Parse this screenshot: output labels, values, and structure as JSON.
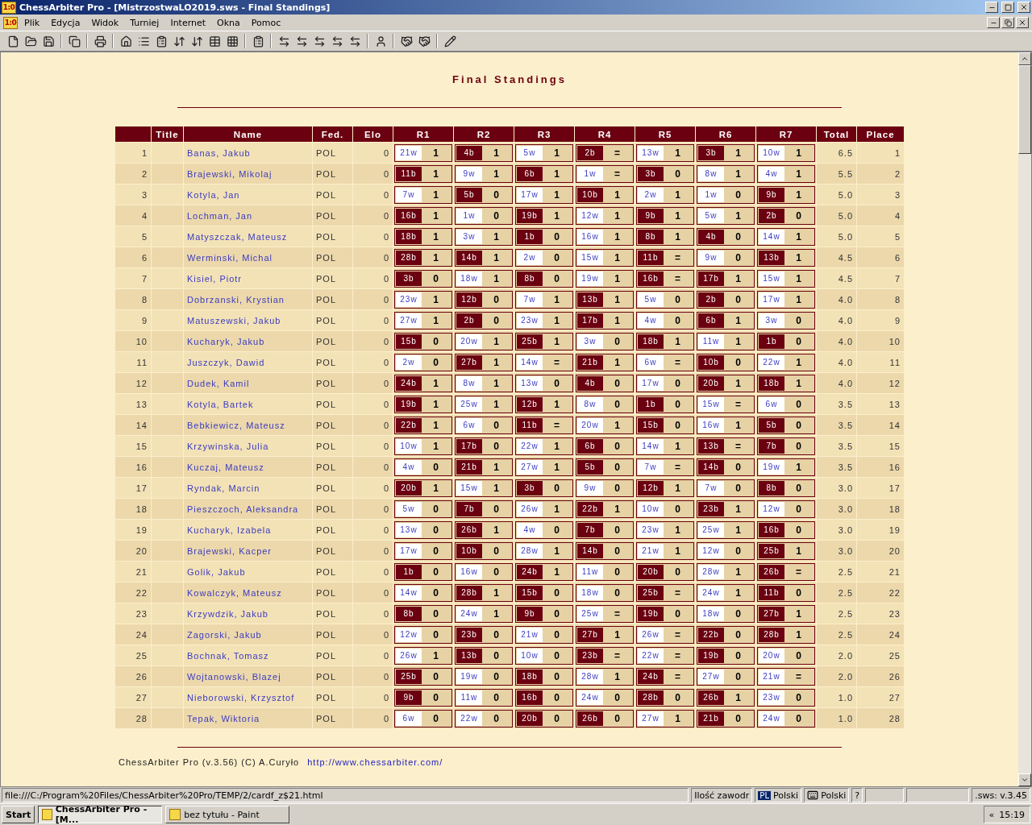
{
  "window": {
    "icon_text": "1:0",
    "title": "ChessArbiter Pro - [MistrzostwaLO2019.sws - Final Standings]"
  },
  "menu": {
    "icon_text": "1:0",
    "items": [
      "Plik",
      "Edycja",
      "Widok",
      "Turniej",
      "Internet",
      "Okna",
      "Pomoc"
    ]
  },
  "page": {
    "heading": "Final Standings",
    "columns": [
      "",
      "Title",
      "Name",
      "Fed.",
      "Elo",
      "R1",
      "R2",
      "R3",
      "R4",
      "R5",
      "R6",
      "R7",
      "Total",
      "Place"
    ],
    "rows": [
      {
        "no": "1",
        "name": "Banas, Jakub",
        "fed": "POL",
        "elo": "0",
        "rounds": [
          {
            "opp": "21w",
            "black": false,
            "result": "1"
          },
          {
            "opp": "4b",
            "black": true,
            "result": "1"
          },
          {
            "opp": "5w",
            "black": false,
            "result": "1"
          },
          {
            "opp": "2b",
            "black": true,
            "result": "="
          },
          {
            "opp": "13w",
            "black": false,
            "result": "1"
          },
          {
            "opp": "3b",
            "black": true,
            "result": "1"
          },
          {
            "opp": "10w",
            "black": false,
            "result": "1"
          }
        ],
        "total": "6.5",
        "place": "1"
      },
      {
        "no": "2",
        "name": "Brajewski, Mikolaj",
        "fed": "POL",
        "elo": "0",
        "rounds": [
          {
            "opp": "11b",
            "black": true,
            "result": "1"
          },
          {
            "opp": "9w",
            "black": false,
            "result": "1"
          },
          {
            "opp": "6b",
            "black": true,
            "result": "1"
          },
          {
            "opp": "1w",
            "black": false,
            "result": "="
          },
          {
            "opp": "3b",
            "black": true,
            "result": "0"
          },
          {
            "opp": "8w",
            "black": false,
            "result": "1"
          },
          {
            "opp": "4w",
            "black": false,
            "result": "1"
          }
        ],
        "total": "5.5",
        "place": "2"
      },
      {
        "no": "3",
        "name": "Kotyla, Jan",
        "fed": "POL",
        "elo": "0",
        "rounds": [
          {
            "opp": "7w",
            "black": false,
            "result": "1"
          },
          {
            "opp": "5b",
            "black": true,
            "result": "0"
          },
          {
            "opp": "17w",
            "black": false,
            "result": "1"
          },
          {
            "opp": "10b",
            "black": true,
            "result": "1"
          },
          {
            "opp": "2w",
            "black": false,
            "result": "1"
          },
          {
            "opp": "1w",
            "black": false,
            "result": "0"
          },
          {
            "opp": "9b",
            "black": true,
            "result": "1"
          }
        ],
        "total": "5.0",
        "place": "3"
      },
      {
        "no": "4",
        "name": "Lochman, Jan",
        "fed": "POL",
        "elo": "0",
        "rounds": [
          {
            "opp": "16b",
            "black": true,
            "result": "1"
          },
          {
            "opp": "1w",
            "black": false,
            "result": "0"
          },
          {
            "opp": "19b",
            "black": true,
            "result": "1"
          },
          {
            "opp": "12w",
            "black": false,
            "result": "1"
          },
          {
            "opp": "9b",
            "black": true,
            "result": "1"
          },
          {
            "opp": "5w",
            "black": false,
            "result": "1"
          },
          {
            "opp": "2b",
            "black": true,
            "result": "0"
          }
        ],
        "total": "5.0",
        "place": "4"
      },
      {
        "no": "5",
        "name": "Matyszczak, Mateusz",
        "fed": "POL",
        "elo": "0",
        "rounds": [
          {
            "opp": "18b",
            "black": true,
            "result": "1"
          },
          {
            "opp": "3w",
            "black": false,
            "result": "1"
          },
          {
            "opp": "1b",
            "black": true,
            "result": "0"
          },
          {
            "opp": "16w",
            "black": false,
            "result": "1"
          },
          {
            "opp": "8b",
            "black": true,
            "result": "1"
          },
          {
            "opp": "4b",
            "black": true,
            "result": "0"
          },
          {
            "opp": "14w",
            "black": false,
            "result": "1"
          }
        ],
        "total": "5.0",
        "place": "5"
      },
      {
        "no": "6",
        "name": "Werminski, Michal",
        "fed": "POL",
        "elo": "0",
        "rounds": [
          {
            "opp": "28b",
            "black": true,
            "result": "1"
          },
          {
            "opp": "14b",
            "black": true,
            "result": "1"
          },
          {
            "opp": "2w",
            "black": false,
            "result": "0"
          },
          {
            "opp": "15w",
            "black": false,
            "result": "1"
          },
          {
            "opp": "11b",
            "black": true,
            "result": "="
          },
          {
            "opp": "9w",
            "black": false,
            "result": "0"
          },
          {
            "opp": "13b",
            "black": true,
            "result": "1"
          }
        ],
        "total": "4.5",
        "place": "6"
      },
      {
        "no": "7",
        "name": "Kisiel, Piotr",
        "fed": "POL",
        "elo": "0",
        "rounds": [
          {
            "opp": "3b",
            "black": true,
            "result": "0"
          },
          {
            "opp": "18w",
            "black": false,
            "result": "1"
          },
          {
            "opp": "8b",
            "black": true,
            "result": "0"
          },
          {
            "opp": "19w",
            "black": false,
            "result": "1"
          },
          {
            "opp": "16b",
            "black": true,
            "result": "="
          },
          {
            "opp": "17b",
            "black": true,
            "result": "1"
          },
          {
            "opp": "15w",
            "black": false,
            "result": "1"
          }
        ],
        "total": "4.5",
        "place": "7"
      },
      {
        "no": "8",
        "name": "Dobrzanski, Krystian",
        "fed": "POL",
        "elo": "0",
        "rounds": [
          {
            "opp": "23w",
            "black": false,
            "result": "1"
          },
          {
            "opp": "12b",
            "black": true,
            "result": "0"
          },
          {
            "opp": "7w",
            "black": false,
            "result": "1"
          },
          {
            "opp": "13b",
            "black": true,
            "result": "1"
          },
          {
            "opp": "5w",
            "black": false,
            "result": "0"
          },
          {
            "opp": "2b",
            "black": true,
            "result": "0"
          },
          {
            "opp": "17w",
            "black": false,
            "result": "1"
          }
        ],
        "total": "4.0",
        "place": "8"
      },
      {
        "no": "9",
        "name": "Matuszewski, Jakub",
        "fed": "POL",
        "elo": "0",
        "rounds": [
          {
            "opp": "27w",
            "black": false,
            "result": "1"
          },
          {
            "opp": "2b",
            "black": true,
            "result": "0"
          },
          {
            "opp": "23w",
            "black": false,
            "result": "1"
          },
          {
            "opp": "17b",
            "black": true,
            "result": "1"
          },
          {
            "opp": "4w",
            "black": false,
            "result": "0"
          },
          {
            "opp": "6b",
            "black": true,
            "result": "1"
          },
          {
            "opp": "3w",
            "black": false,
            "result": "0"
          }
        ],
        "total": "4.0",
        "place": "9"
      },
      {
        "no": "10",
        "name": "Kucharyk, Jakub",
        "fed": "POL",
        "elo": "0",
        "rounds": [
          {
            "opp": "15b",
            "black": true,
            "result": "0"
          },
          {
            "opp": "20w",
            "black": false,
            "result": "1"
          },
          {
            "opp": "25b",
            "black": true,
            "result": "1"
          },
          {
            "opp": "3w",
            "black": false,
            "result": "0"
          },
          {
            "opp": "18b",
            "black": true,
            "result": "1"
          },
          {
            "opp": "11w",
            "black": false,
            "result": "1"
          },
          {
            "opp": "1b",
            "black": true,
            "result": "0"
          }
        ],
        "total": "4.0",
        "place": "10"
      },
      {
        "no": "11",
        "name": "Juszczyk, Dawid",
        "fed": "POL",
        "elo": "0",
        "rounds": [
          {
            "opp": "2w",
            "black": false,
            "result": "0"
          },
          {
            "opp": "27b",
            "black": true,
            "result": "1"
          },
          {
            "opp": "14w",
            "black": false,
            "result": "="
          },
          {
            "opp": "21b",
            "black": true,
            "result": "1"
          },
          {
            "opp": "6w",
            "black": false,
            "result": "="
          },
          {
            "opp": "10b",
            "black": true,
            "result": "0"
          },
          {
            "opp": "22w",
            "black": false,
            "result": "1"
          }
        ],
        "total": "4.0",
        "place": "11"
      },
      {
        "no": "12",
        "name": "Dudek, Kamil",
        "fed": "POL",
        "elo": "0",
        "rounds": [
          {
            "opp": "24b",
            "black": true,
            "result": "1"
          },
          {
            "opp": "8w",
            "black": false,
            "result": "1"
          },
          {
            "opp": "13w",
            "black": false,
            "result": "0"
          },
          {
            "opp": "4b",
            "black": true,
            "result": "0"
          },
          {
            "opp": "17w",
            "black": false,
            "result": "0"
          },
          {
            "opp": "20b",
            "black": true,
            "result": "1"
          },
          {
            "opp": "18b",
            "black": true,
            "result": "1"
          }
        ],
        "total": "4.0",
        "place": "12"
      },
      {
        "no": "13",
        "name": "Kotyla, Bartek",
        "fed": "POL",
        "elo": "0",
        "rounds": [
          {
            "opp": "19b",
            "black": true,
            "result": "1"
          },
          {
            "opp": "25w",
            "black": false,
            "result": "1"
          },
          {
            "opp": "12b",
            "black": true,
            "result": "1"
          },
          {
            "opp": "8w",
            "black": false,
            "result": "0"
          },
          {
            "opp": "1b",
            "black": true,
            "result": "0"
          },
          {
            "opp": "15w",
            "black": false,
            "result": "="
          },
          {
            "opp": "6w",
            "black": false,
            "result": "0"
          }
        ],
        "total": "3.5",
        "place": "13"
      },
      {
        "no": "14",
        "name": "Bebkiewicz, Mateusz",
        "fed": "POL",
        "elo": "0",
        "rounds": [
          {
            "opp": "22b",
            "black": true,
            "result": "1"
          },
          {
            "opp": "6w",
            "black": false,
            "result": "0"
          },
          {
            "opp": "11b",
            "black": true,
            "result": "="
          },
          {
            "opp": "20w",
            "black": false,
            "result": "1"
          },
          {
            "opp": "15b",
            "black": true,
            "result": "0"
          },
          {
            "opp": "16w",
            "black": false,
            "result": "1"
          },
          {
            "opp": "5b",
            "black": true,
            "result": "0"
          }
        ],
        "total": "3.5",
        "place": "14"
      },
      {
        "no": "15",
        "name": "Krzywinska, Julia",
        "fed": "POL",
        "elo": "0",
        "rounds": [
          {
            "opp": "10w",
            "black": false,
            "result": "1"
          },
          {
            "opp": "17b",
            "black": true,
            "result": "0"
          },
          {
            "opp": "22w",
            "black": false,
            "result": "1"
          },
          {
            "opp": "6b",
            "black": true,
            "result": "0"
          },
          {
            "opp": "14w",
            "black": false,
            "result": "1"
          },
          {
            "opp": "13b",
            "black": true,
            "result": "="
          },
          {
            "opp": "7b",
            "black": true,
            "result": "0"
          }
        ],
        "total": "3.5",
        "place": "15"
      },
      {
        "no": "16",
        "name": "Kuczaj, Mateusz",
        "fed": "POL",
        "elo": "0",
        "rounds": [
          {
            "opp": "4w",
            "black": false,
            "result": "0"
          },
          {
            "opp": "21b",
            "black": true,
            "result": "1"
          },
          {
            "opp": "27w",
            "black": false,
            "result": "1"
          },
          {
            "opp": "5b",
            "black": true,
            "result": "0"
          },
          {
            "opp": "7w",
            "black": false,
            "result": "="
          },
          {
            "opp": "14b",
            "black": true,
            "result": "0"
          },
          {
            "opp": "19w",
            "black": false,
            "result": "1"
          }
        ],
        "total": "3.5",
        "place": "16"
      },
      {
        "no": "17",
        "name": "Ryndak, Marcin",
        "fed": "POL",
        "elo": "0",
        "rounds": [
          {
            "opp": "20b",
            "black": true,
            "result": "1"
          },
          {
            "opp": "15w",
            "black": false,
            "result": "1"
          },
          {
            "opp": "3b",
            "black": true,
            "result": "0"
          },
          {
            "opp": "9w",
            "black": false,
            "result": "0"
          },
          {
            "opp": "12b",
            "black": true,
            "result": "1"
          },
          {
            "opp": "7w",
            "black": false,
            "result": "0"
          },
          {
            "opp": "8b",
            "black": true,
            "result": "0"
          }
        ],
        "total": "3.0",
        "place": "17"
      },
      {
        "no": "18",
        "name": "Pieszczoch, Aleksandra",
        "fed": "POL",
        "elo": "0",
        "rounds": [
          {
            "opp": "5w",
            "black": false,
            "result": "0"
          },
          {
            "opp": "7b",
            "black": true,
            "result": "0"
          },
          {
            "opp": "26w",
            "black": false,
            "result": "1"
          },
          {
            "opp": "22b",
            "black": true,
            "result": "1"
          },
          {
            "opp": "10w",
            "black": false,
            "result": "0"
          },
          {
            "opp": "23b",
            "black": true,
            "result": "1"
          },
          {
            "opp": "12w",
            "black": false,
            "result": "0"
          }
        ],
        "total": "3.0",
        "place": "18"
      },
      {
        "no": "19",
        "name": "Kucharyk, Izabela",
        "fed": "POL",
        "elo": "0",
        "rounds": [
          {
            "opp": "13w",
            "black": false,
            "result": "0"
          },
          {
            "opp": "26b",
            "black": true,
            "result": "1"
          },
          {
            "opp": "4w",
            "black": false,
            "result": "0"
          },
          {
            "opp": "7b",
            "black": true,
            "result": "0"
          },
          {
            "opp": "23w",
            "black": false,
            "result": "1"
          },
          {
            "opp": "25w",
            "black": false,
            "result": "1"
          },
          {
            "opp": "16b",
            "black": true,
            "result": "0"
          }
        ],
        "total": "3.0",
        "place": "19"
      },
      {
        "no": "20",
        "name": "Brajewski, Kacper",
        "fed": "POL",
        "elo": "0",
        "rounds": [
          {
            "opp": "17w",
            "black": false,
            "result": "0"
          },
          {
            "opp": "10b",
            "black": true,
            "result": "0"
          },
          {
            "opp": "28w",
            "black": false,
            "result": "1"
          },
          {
            "opp": "14b",
            "black": true,
            "result": "0"
          },
          {
            "opp": "21w",
            "black": false,
            "result": "1"
          },
          {
            "opp": "12w",
            "black": false,
            "result": "0"
          },
          {
            "opp": "25b",
            "black": true,
            "result": "1"
          }
        ],
        "total": "3.0",
        "place": "20"
      },
      {
        "no": "21",
        "name": "Golik, Jakub",
        "fed": "POL",
        "elo": "0",
        "rounds": [
          {
            "opp": "1b",
            "black": true,
            "result": "0"
          },
          {
            "opp": "16w",
            "black": false,
            "result": "0"
          },
          {
            "opp": "24b",
            "black": true,
            "result": "1"
          },
          {
            "opp": "11w",
            "black": false,
            "result": "0"
          },
          {
            "opp": "20b",
            "black": true,
            "result": "0"
          },
          {
            "opp": "28w",
            "black": false,
            "result": "1"
          },
          {
            "opp": "26b",
            "black": true,
            "result": "="
          }
        ],
        "total": "2.5",
        "place": "21"
      },
      {
        "no": "22",
        "name": "Kowalczyk, Mateusz",
        "fed": "POL",
        "elo": "0",
        "rounds": [
          {
            "opp": "14w",
            "black": false,
            "result": "0"
          },
          {
            "opp": "28b",
            "black": true,
            "result": "1"
          },
          {
            "opp": "15b",
            "black": true,
            "result": "0"
          },
          {
            "opp": "18w",
            "black": false,
            "result": "0"
          },
          {
            "opp": "25b",
            "black": true,
            "result": "="
          },
          {
            "opp": "24w",
            "black": false,
            "result": "1"
          },
          {
            "opp": "11b",
            "black": true,
            "result": "0"
          }
        ],
        "total": "2.5",
        "place": "22"
      },
      {
        "no": "23",
        "name": "Krzywdzik, Jakub",
        "fed": "POL",
        "elo": "0",
        "rounds": [
          {
            "opp": "8b",
            "black": true,
            "result": "0"
          },
          {
            "opp": "24w",
            "black": false,
            "result": "1"
          },
          {
            "opp": "9b",
            "black": true,
            "result": "0"
          },
          {
            "opp": "25w",
            "black": false,
            "result": "="
          },
          {
            "opp": "19b",
            "black": true,
            "result": "0"
          },
          {
            "opp": "18w",
            "black": false,
            "result": "0"
          },
          {
            "opp": "27b",
            "black": true,
            "result": "1"
          }
        ],
        "total": "2.5",
        "place": "23"
      },
      {
        "no": "24",
        "name": "Zagorski, Jakub",
        "fed": "POL",
        "elo": "0",
        "rounds": [
          {
            "opp": "12w",
            "black": false,
            "result": "0"
          },
          {
            "opp": "23b",
            "black": true,
            "result": "0"
          },
          {
            "opp": "21w",
            "black": false,
            "result": "0"
          },
          {
            "opp": "27b",
            "black": true,
            "result": "1"
          },
          {
            "opp": "26w",
            "black": false,
            "result": "="
          },
          {
            "opp": "22b",
            "black": true,
            "result": "0"
          },
          {
            "opp": "28b",
            "black": true,
            "result": "1"
          }
        ],
        "total": "2.5",
        "place": "24"
      },
      {
        "no": "25",
        "name": "Bochnak, Tomasz",
        "fed": "POL",
        "elo": "0",
        "rounds": [
          {
            "opp": "26w",
            "black": false,
            "result": "1"
          },
          {
            "opp": "13b",
            "black": true,
            "result": "0"
          },
          {
            "opp": "10w",
            "black": false,
            "result": "0"
          },
          {
            "opp": "23b",
            "black": true,
            "result": "="
          },
          {
            "opp": "22w",
            "black": false,
            "result": "="
          },
          {
            "opp": "19b",
            "black": true,
            "result": "0"
          },
          {
            "opp": "20w",
            "black": false,
            "result": "0"
          }
        ],
        "total": "2.0",
        "place": "25"
      },
      {
        "no": "26",
        "name": "Wojtanowski, Blazej",
        "fed": "POL",
        "elo": "0",
        "rounds": [
          {
            "opp": "25b",
            "black": true,
            "result": "0"
          },
          {
            "opp": "19w",
            "black": false,
            "result": "0"
          },
          {
            "opp": "18b",
            "black": true,
            "result": "0"
          },
          {
            "opp": "28w",
            "black": false,
            "result": "1"
          },
          {
            "opp": "24b",
            "black": true,
            "result": "="
          },
          {
            "opp": "27w",
            "black": false,
            "result": "0"
          },
          {
            "opp": "21w",
            "black": false,
            "result": "="
          }
        ],
        "total": "2.0",
        "place": "26"
      },
      {
        "no": "27",
        "name": "Nieborowski, Krzysztof",
        "fed": "POL",
        "elo": "0",
        "rounds": [
          {
            "opp": "9b",
            "black": true,
            "result": "0"
          },
          {
            "opp": "11w",
            "black": false,
            "result": "0"
          },
          {
            "opp": "16b",
            "black": true,
            "result": "0"
          },
          {
            "opp": "24w",
            "black": false,
            "result": "0"
          },
          {
            "opp": "28b",
            "black": true,
            "result": "0"
          },
          {
            "opp": "26b",
            "black": true,
            "result": "1"
          },
          {
            "opp": "23w",
            "black": false,
            "result": "0"
          }
        ],
        "total": "1.0",
        "place": "27"
      },
      {
        "no": "28",
        "name": "Tepak, Wiktoria",
        "fed": "POL",
        "elo": "0",
        "rounds": [
          {
            "opp": "6w",
            "black": false,
            "result": "0"
          },
          {
            "opp": "22w",
            "black": false,
            "result": "0"
          },
          {
            "opp": "20b",
            "black": true,
            "result": "0"
          },
          {
            "opp": "26b",
            "black": true,
            "result": "0"
          },
          {
            "opp": "27w",
            "black": false,
            "result": "1"
          },
          {
            "opp": "21b",
            "black": true,
            "result": "0"
          },
          {
            "opp": "24w",
            "black": false,
            "result": "0"
          }
        ],
        "total": "1.0",
        "place": "28"
      }
    ],
    "footer_text": "ChessArbiter Pro (v.3.56) (C) A.Curyło",
    "footer_link": "http://www.chessarbiter.com/"
  },
  "status_bar": {
    "url": "file:///C:/Program%20Files/ChessArbiter%20Pro/TEMP/2/cardf_z$21.html",
    "players": "Ilość zawodr",
    "lang_code": "PL",
    "language": "Polski",
    "keyboard": "Polski",
    "help": "?",
    "version": ".sws: v.3.45"
  },
  "taskbar": {
    "start": "Start",
    "tasks": [
      {
        "label": "ChessArbiter Pro - [M...",
        "selected": true
      },
      {
        "label": "bez tytułu - Paint",
        "selected": false
      }
    ],
    "chevron": "«",
    "clock": "15:19"
  }
}
